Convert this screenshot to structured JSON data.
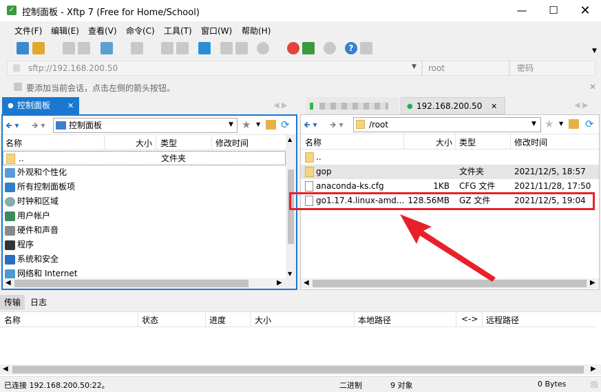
{
  "window": {
    "title": "控制面板 - Xftp 7 (Free for Home/School)",
    "app_icon": "xftp-icon"
  },
  "menu": [
    "文件(F)",
    "编辑(E)",
    "查看(V)",
    "命令(C)",
    "工具(T)",
    "窗口(W)",
    "帮助(H)"
  ],
  "address": {
    "url": "sftp://192.168.200.50",
    "user_placeholder": "root",
    "password_placeholder": "密码"
  },
  "hint": "要添加当前会话，点击左侧的箭头按钮。",
  "tabs": {
    "left": "控制面板",
    "right_blurred": "[blurred]",
    "right": "192.168.200.50"
  },
  "left_pane": {
    "path": "控制面板",
    "headers": {
      "name": "名称",
      "size": "大小",
      "type": "类型",
      "modified": "修改时间"
    },
    "rows": [
      {
        "name": "..",
        "size": "",
        "type": "文件夹",
        "modified": "",
        "icon": "folder-icon"
      },
      {
        "name": "外观和个性化",
        "icon": "appearance-icon"
      },
      {
        "name": "所有控制面板项",
        "icon": "control-panel-icon"
      },
      {
        "name": "时钟和区域",
        "icon": "clock-icon"
      },
      {
        "name": "用户帐户",
        "icon": "users-icon"
      },
      {
        "name": "硬件和声音",
        "icon": "hardware-icon"
      },
      {
        "name": "程序",
        "icon": "programs-icon"
      },
      {
        "name": "系统和安全",
        "icon": "security-icon"
      },
      {
        "name": "网络和 Internet",
        "icon": "network-icon"
      }
    ]
  },
  "right_pane": {
    "path": "/root",
    "headers": {
      "name": "名称",
      "size": "大小",
      "type": "类型",
      "modified": "修改时间"
    },
    "rows": [
      {
        "name": "..",
        "size": "",
        "type": "",
        "modified": "",
        "icon": "folder-icon"
      },
      {
        "name": "gop",
        "size": "",
        "type": "文件夹",
        "modified": "2021/12/5, 18:57",
        "icon": "folder-icon"
      },
      {
        "name": "anaconda-ks.cfg",
        "size": "1KB",
        "type": "CFG 文件",
        "modified": "2021/11/28, 17:50",
        "icon": "file-icon"
      },
      {
        "name": "go1.17.4.linux-amd...",
        "size": "128.56MB",
        "type": "GZ 文件",
        "modified": "2021/12/5, 19:04",
        "icon": "file-icon"
      }
    ]
  },
  "bottom_tabs": [
    "传输",
    "日志"
  ],
  "transfer_headers": {
    "name": "名称",
    "status": "状态",
    "progress": "进度",
    "size": "大小",
    "local": "本地路径",
    "arrow": "<->",
    "remote": "远程路径"
  },
  "status": {
    "connection": "已连接 192.168.200.50:22。",
    "mode": "二进制",
    "objects": "9 对象",
    "bytes": "0 Bytes"
  },
  "colors": {
    "accent": "#1b78d0",
    "highlight": "#e8202a",
    "connected": "#1bb34a"
  }
}
